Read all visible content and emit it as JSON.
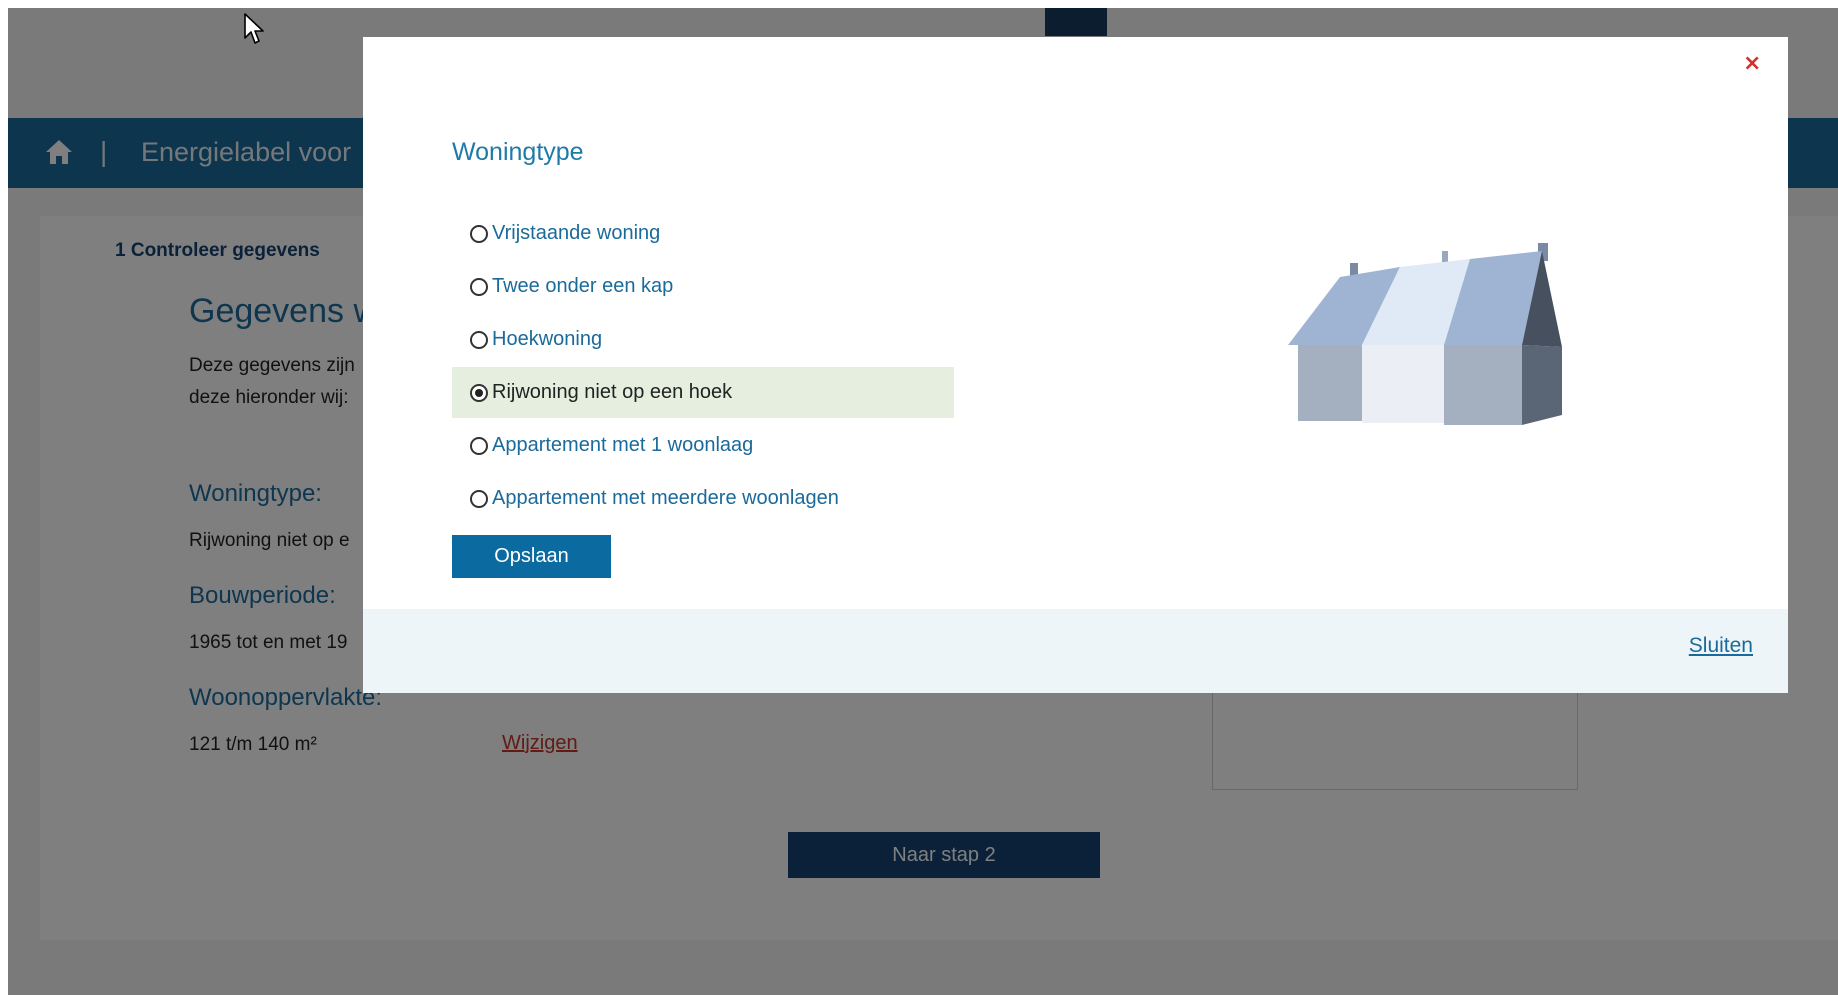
{
  "header": {
    "app_title": "Energielabel voor",
    "separator": "|"
  },
  "stepper": {
    "current_step": "1 Controleer gegevens"
  },
  "main": {
    "heading": "Gegevens w",
    "intro_lines": [
      "Deze gegevens zijn",
      "deze hieronder wij:"
    ],
    "fields": {
      "woningtype_label": "Woningtype:",
      "woningtype_value": "Rijwoning niet op e",
      "bouwperiode_label": "Bouwperiode:",
      "bouwperiode_value": "1965 tot en met 19",
      "woonoppervlakte_label": "Woonoppervlakte:",
      "woonoppervlakte_value": "121 t/m 140 m²"
    },
    "change_link": "Wijzigen",
    "next_button": "Naar stap 2"
  },
  "modal": {
    "close_symbol": "×",
    "title": "Woningtype",
    "options": [
      {
        "label": "Vrijstaande woning",
        "selected": false
      },
      {
        "label": "Twee onder een kap",
        "selected": false
      },
      {
        "label": "Hoekwoning",
        "selected": false
      },
      {
        "label": "Rijwoning niet op een hoek",
        "selected": true
      },
      {
        "label": "Appartement met 1 woonlaag",
        "selected": false
      },
      {
        "label": "Appartement met meerdere woonlagen",
        "selected": false
      }
    ],
    "save_button": "Opslaan",
    "footer_close": "Sluiten"
  },
  "icons": {
    "home": "home-icon",
    "cursor": "cursor-arrow-icon",
    "house_illustration": "row-house-illustration"
  },
  "colors": {
    "header_bg": "#1a6a9b",
    "primary_dark": "#154273",
    "link_red": "#c0392b",
    "selected_bg": "#e5eedf",
    "modal_footer_bg": "#eef5f9"
  }
}
